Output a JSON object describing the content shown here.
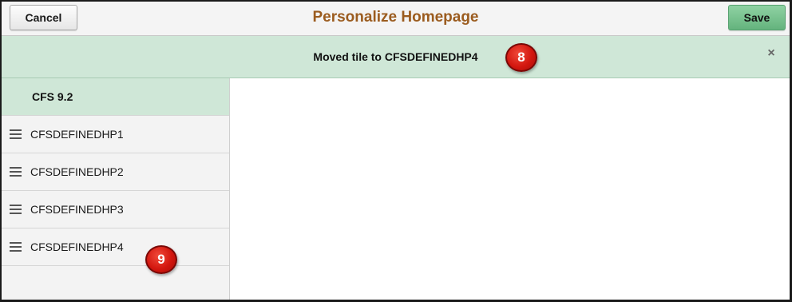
{
  "header": {
    "title": "Personalize Homepage",
    "cancel_label": "Cancel",
    "save_label": "Save"
  },
  "banner": {
    "message": "Moved tile to CFSDEFINEDHP4",
    "close_icon": "×"
  },
  "callouts": {
    "c8": "8",
    "c9": "9"
  },
  "sidebar": {
    "selected": "CFS 9.2",
    "items": [
      {
        "label": "CFSDEFINEDHP1"
      },
      {
        "label": "CFSDEFINEDHP2"
      },
      {
        "label": "CFSDEFINEDHP3"
      },
      {
        "label": "CFSDEFINEDHP4"
      }
    ]
  },
  "colors": {
    "title": "#9b5c1f",
    "banner_bg": "#cfe7d7",
    "save_button": "#64b37d",
    "callout": "#d3170f"
  },
  "icons": {
    "drag": "drag-handle-icon",
    "close": "close-icon"
  }
}
